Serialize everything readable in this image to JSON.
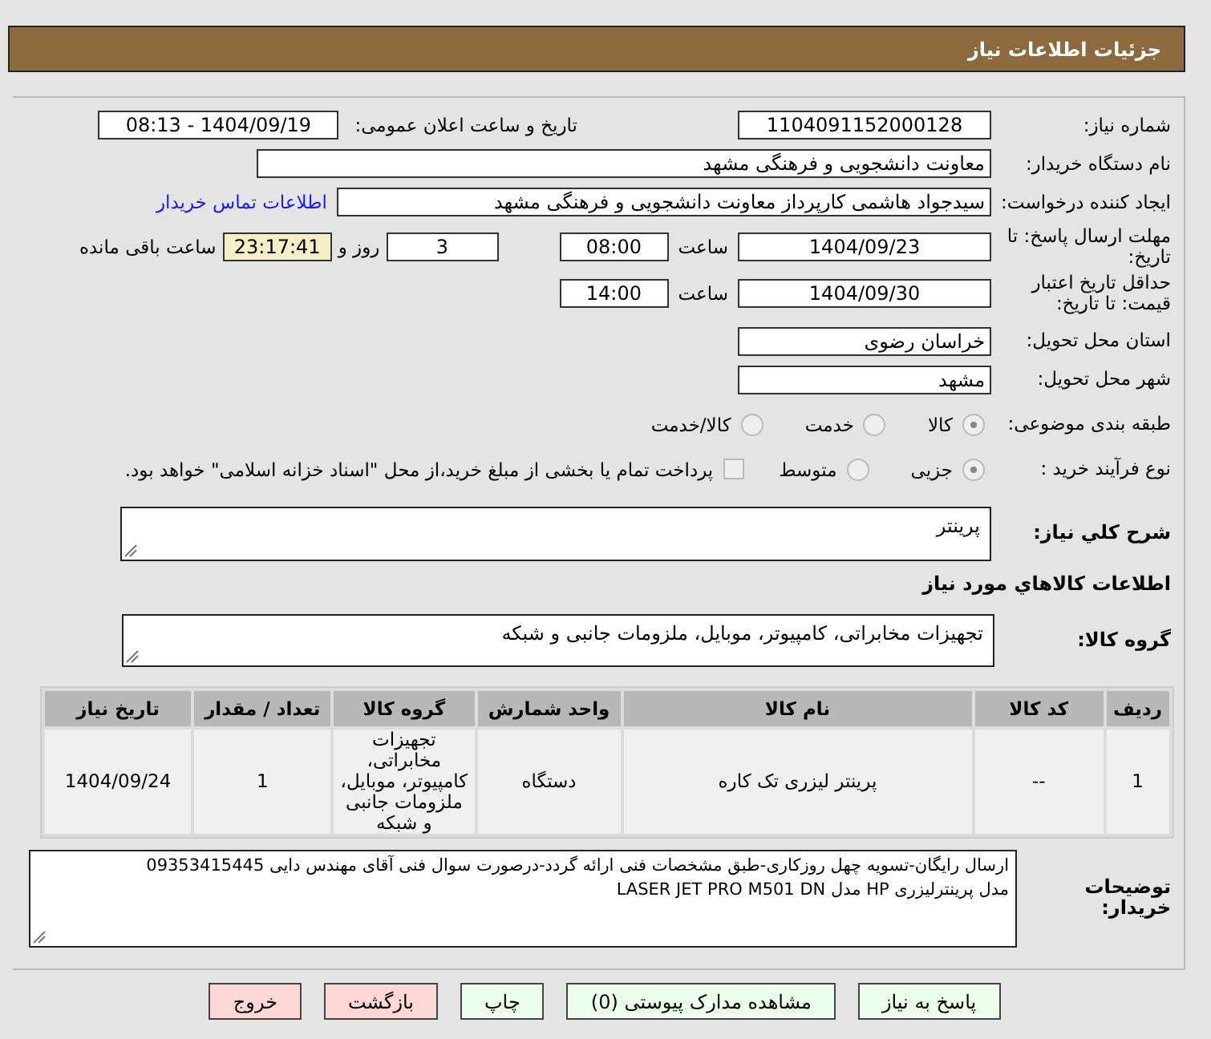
{
  "header": {
    "title": "جزئیات اطلاعات نیاز"
  },
  "need_number": {
    "label": "شماره نیاز:",
    "value": "1104091152000128"
  },
  "announce": {
    "label": "تاریخ و ساعت اعلان عمومی:",
    "value": "1404/09/19 - 08:13"
  },
  "buyer": {
    "label": "نام دستگاه خریدار:",
    "value": "معاونت دانشجویی و فرهنگی مشهد"
  },
  "creator": {
    "label": "ایجاد کننده درخواست:",
    "value": "سیدجواد هاشمی کارپرداز معاونت دانشجویی و فرهنگی مشهد",
    "link": "اطلاعات تماس خریدار"
  },
  "deadline": {
    "label": "مهلت ارسال پاسخ: تا تاریخ:",
    "date": "1404/09/23",
    "time_label": "ساعت",
    "time": "08:00",
    "days": "3",
    "days_label": "روز و",
    "remaining": "23:17:41",
    "remaining_label": "ساعت باقی مانده"
  },
  "validity": {
    "label": "حداقل تاریخ اعتبار قیمت: تا تاریخ:",
    "date": "1404/09/30",
    "time_label": "ساعت",
    "time": "14:00"
  },
  "province": {
    "label": "استان محل تحویل:",
    "value": "خراسان رضوی"
  },
  "city": {
    "label": "شهر محل تحویل:",
    "value": "مشهد"
  },
  "category": {
    "label": "طبقه بندی موضوعی:",
    "options": [
      {
        "label": "کالا",
        "selected": true
      },
      {
        "label": "خدمت",
        "selected": false
      },
      {
        "label": "کالا/خدمت",
        "selected": false
      }
    ]
  },
  "process": {
    "label": "نوع فرآیند خرید :",
    "options": [
      {
        "label": "جزیی",
        "selected": true
      },
      {
        "label": "متوسط",
        "selected": false
      }
    ],
    "payment": {
      "label": "پرداخت تمام یا بخشی از مبلغ خرید،از محل \"اسناد خزانه اسلامی\" خواهد بود.",
      "checked": false
    }
  },
  "summary": {
    "label": "شرح كلي نياز:",
    "value": "پرینتر"
  },
  "goods_title": "اطلاعات كالاهاي مورد نياز",
  "goods_group": {
    "label": "گروه کالا:",
    "value": "تجهیزات مخابراتی، کامپیوتر، موبایل، ملزومات جانبی و شبکه"
  },
  "table": {
    "columns": [
      "ردیف",
      "کد کالا",
      "نام کالا",
      "واحد شمارش",
      "گروه کالا",
      "تعداد / مقدار",
      "تاریخ نیاز"
    ],
    "rows": [
      [
        "1",
        "--",
        "پرینتر لیزری تک کاره",
        "دستگاه",
        "تجهیزات مخابراتی، کامپیوتر، موبایل، ملزومات جانبی و شبکه",
        "1",
        "1404/09/24"
      ]
    ]
  },
  "notes": {
    "label": "توضیحات خریدار:",
    "lines": [
      "ارسال رایگان-تسویه چهل روزکاری-طبق مشخصات فنی ارائه گردد-درصورت سوال فنی آقای مهندس دایی 09353415445",
      "مدل پرینترلیزری HP مدل LASER JET PRO M501 DN"
    ]
  },
  "buttons": [
    {
      "label": "پاسخ به نیاز",
      "kind": "ok"
    },
    {
      "label": "مشاهده مدارک پیوستی (0)",
      "kind": "ok"
    },
    {
      "label": "چاپ",
      "kind": "ok"
    },
    {
      "label": "بازگشت",
      "kind": "warn"
    },
    {
      "label": "خروج",
      "kind": "warn"
    }
  ]
}
